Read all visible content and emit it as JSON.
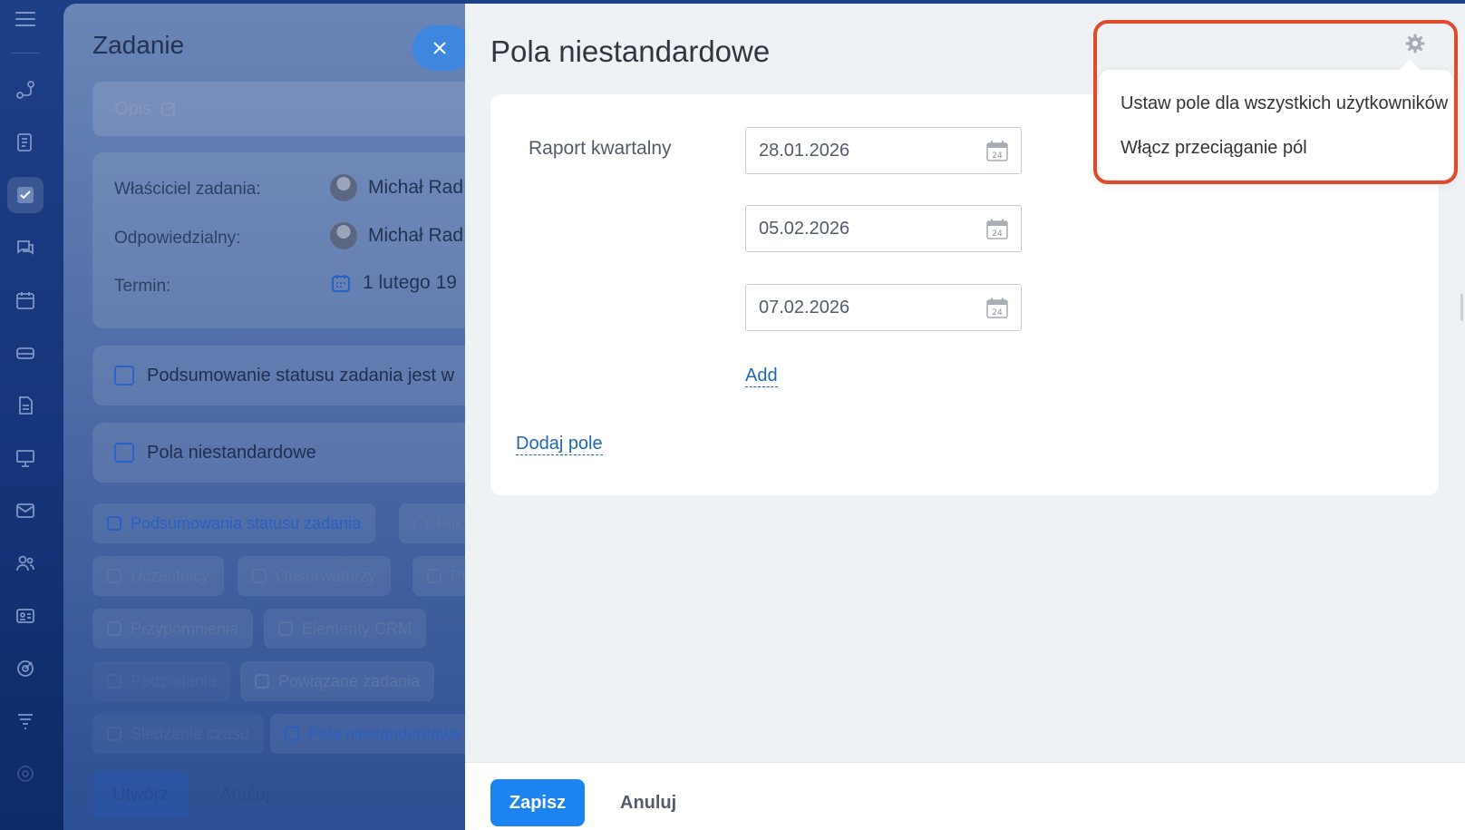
{
  "background_task": {
    "title": "Zadanie",
    "description_placeholder": "Opis",
    "owner_label": "Właściciel zadania:",
    "owner_name": "Michał Rad",
    "responsible_label": "Odpowiedzialny:",
    "responsible_name": "Michał Rad",
    "deadline_label": "Termin:",
    "deadline_value": "1 lutego 19",
    "status_summary_section": "Podsumowanie statusu zadania jest w",
    "custom_fields_section": "Pola niestandardowe",
    "chips": [
      "Podsumowania statusu zadania",
      "Plik",
      "Uczestnicy",
      "Obserwatorzy",
      "Pr",
      "Przypomnienia",
      "Elementy CRM",
      "Podzadania",
      "Powiązane zadania",
      "Śledzenie czasu",
      "Pola niestandardowe"
    ],
    "create_button": "Utwórz",
    "cancel_button": "Anuluj"
  },
  "slider": {
    "title": "Pola niestandardowe",
    "field": {
      "label": "Raport kwartalny",
      "dates": [
        "28.01.2026",
        "05.02.2026",
        "07.02.2026"
      ],
      "calendar_day": "24"
    },
    "add_link": "Add",
    "add_field_link": "Dodaj pole",
    "save_button": "Zapisz",
    "cancel_button": "Anuluj"
  },
  "settings_menu": {
    "items": [
      "Ustaw pole dla wszystkich użytkowników",
      "Włącz przeciąganie pól"
    ]
  },
  "colors": {
    "accent": "#1d83f0",
    "link": "#2066b0",
    "highlight": "#e04a2c"
  }
}
